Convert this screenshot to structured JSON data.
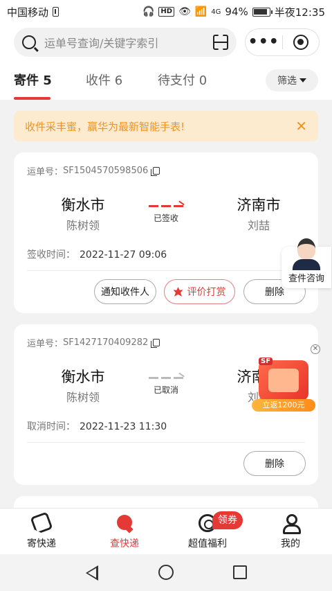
{
  "status_bar": {
    "carrier": "中国移动",
    "network": "4G",
    "battery_percent": "94%",
    "time": "半夜12:35"
  },
  "search": {
    "placeholder": "运单号查询/关键字索引"
  },
  "tabs": [
    {
      "label": "寄件",
      "count": "5"
    },
    {
      "label": "收件",
      "count": "6"
    },
    {
      "label": "待支付",
      "count": "0"
    }
  ],
  "filter_label": "筛选",
  "notice": {
    "text": "收件采丰蜜，赢华为最新智能手表!"
  },
  "shipments": [
    {
      "waybill_label": "运单号：",
      "waybill_no": "SF1504570598506",
      "from_city": "衡水市",
      "from_person": "陈树领",
      "to_city": "济南市",
      "to_person": "刘喆",
      "status": "已签收",
      "time_label": "签收时间：",
      "time_value": "2022-11-27 09:06",
      "buttons": [
        "通知收件人",
        "评价打赏",
        "删除"
      ]
    },
    {
      "waybill_label": "运单号：",
      "waybill_no": "SF1427170409282",
      "from_city": "衡水市",
      "from_person": "陈树领",
      "to_city": "济南市",
      "to_person": "刘喆",
      "status": "已取消",
      "time_label": "取消时间：",
      "time_value": "2022-11-23 11:30",
      "buttons": [
        "删除"
      ]
    }
  ],
  "consult": {
    "label": "查件咨询"
  },
  "promo": {
    "badge": "SF",
    "tag": "立返1200元"
  },
  "bottom_nav": [
    {
      "label": "寄快递",
      "icon": "send-icon"
    },
    {
      "label": "查快递",
      "icon": "track-icon",
      "active": true
    },
    {
      "label": "超值福利",
      "icon": "welfare-icon"
    },
    {
      "label": "我的",
      "icon": "profile-icon"
    }
  ],
  "coupon_badge": "领券",
  "colors": {
    "accent": "#e53935",
    "notice_bg": "#fdebd0",
    "notice_text": "#f19321"
  }
}
